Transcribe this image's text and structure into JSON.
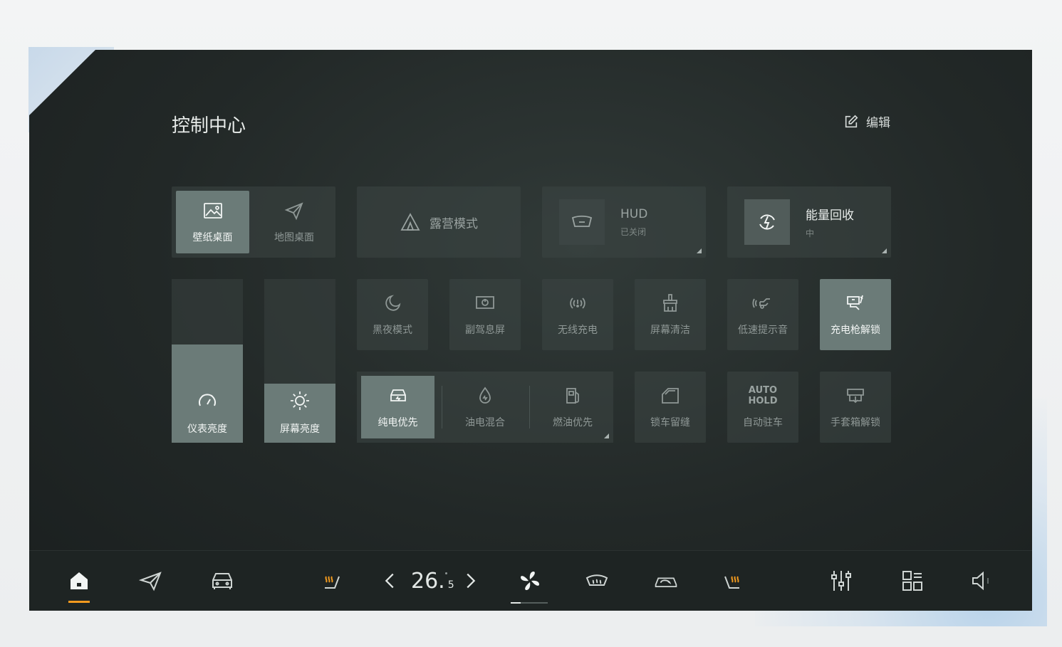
{
  "header": {
    "title": "控制中心",
    "edit_label": "编辑"
  },
  "desktop": {
    "wallpaper_label": "壁纸桌面",
    "map_label": "地图桌面",
    "selected": "壁纸桌面"
  },
  "camping": {
    "label": "露营模式"
  },
  "hud": {
    "title": "HUD",
    "status": "已关闭"
  },
  "energy": {
    "title": "能量回收",
    "status": "中"
  },
  "sliders": {
    "instrument": {
      "label": "仪表亮度",
      "level_percent": 60
    },
    "screen": {
      "label": "屏幕亮度",
      "level_percent": 36
    }
  },
  "row2": [
    {
      "label": "黑夜模式",
      "icon": "moon-icon",
      "active": false
    },
    {
      "label": "副驾息屏",
      "icon": "screen-power-icon",
      "active": false
    },
    {
      "label": "无线充电",
      "icon": "wireless-charge-icon",
      "active": false
    },
    {
      "label": "屏幕清洁",
      "icon": "clean-icon",
      "active": false
    },
    {
      "label": "低速提示音",
      "icon": "sound-icon",
      "active": false
    },
    {
      "label": "充电枪解锁",
      "icon": "charge-gun-icon",
      "active": true
    }
  ],
  "power_mode": {
    "ev_label": "纯电优先",
    "hybrid_label": "油电混合",
    "fuel_label": "燃油优先",
    "selected": "纯电优先"
  },
  "row3": {
    "lock_label": "锁车留缝",
    "autohold_line1": "AUTO",
    "autohold_line2": "HOLD",
    "autohold_label": "自动驻车",
    "glovebox_label": "手套箱解锁"
  },
  "navbar": {
    "temp_main": "26.",
    "temp_sub": "5",
    "accent": "#f29a1e"
  }
}
